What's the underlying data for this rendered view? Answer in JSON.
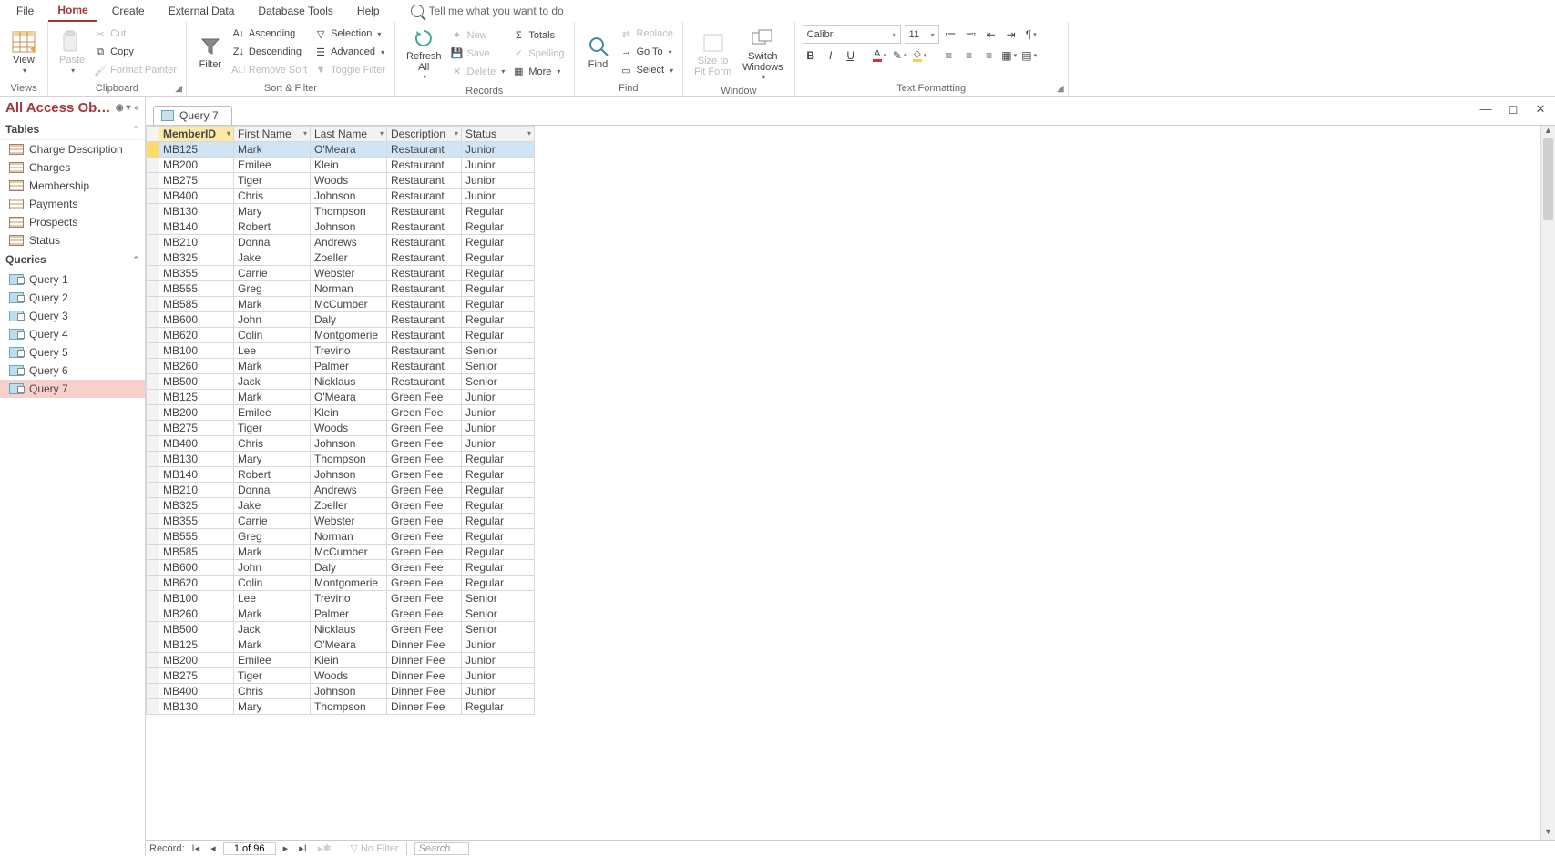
{
  "menubar": {
    "tabs": [
      "File",
      "Home",
      "Create",
      "External Data",
      "Database Tools",
      "Help"
    ],
    "active": 1,
    "tellme": "Tell me what you want to do"
  },
  "ribbon": {
    "views": {
      "label": "Views",
      "btn": "View"
    },
    "clipboard": {
      "label": "Clipboard",
      "paste": "Paste",
      "cut": "Cut",
      "copy": "Copy",
      "fp": "Format Painter"
    },
    "sortfilter": {
      "label": "Sort & Filter",
      "filter": "Filter",
      "asc": "Ascending",
      "desc": "Descending",
      "remove": "Remove Sort",
      "selection": "Selection",
      "advanced": "Advanced",
      "toggle": "Toggle Filter"
    },
    "records": {
      "label": "Records",
      "refresh": "Refresh\nAll",
      "new": "New",
      "save": "Save",
      "delete": "Delete",
      "totals": "Totals",
      "spelling": "Spelling",
      "more": "More"
    },
    "find": {
      "label": "Find",
      "find": "Find",
      "replace": "Replace",
      "goto": "Go To",
      "select": "Select"
    },
    "window": {
      "label": "Window",
      "size": "Size to\nFit Form",
      "switch": "Switch\nWindows"
    },
    "text": {
      "label": "Text Formatting",
      "font": "Calibri",
      "size": "11"
    }
  },
  "nav": {
    "title": "All Access Ob…",
    "groups": [
      {
        "name": "Tables",
        "items": [
          "Charge Description",
          "Charges",
          "Membership",
          "Payments",
          "Prospects",
          "Status"
        ],
        "type": "t"
      },
      {
        "name": "Queries",
        "items": [
          "Query 1",
          "Query 2",
          "Query 3",
          "Query 4",
          "Query 5",
          "Query 6",
          "Query 7"
        ],
        "type": "q",
        "selected": "Query 7"
      }
    ]
  },
  "doc": {
    "tab": "Query 7"
  },
  "grid": {
    "columns": [
      "MemberID",
      "First Name",
      "Last Name",
      "Description",
      "Status"
    ],
    "sorted_col": 0,
    "rows": [
      [
        "MB125",
        "Mark",
        "O'Meara",
        "Restaurant",
        "Junior"
      ],
      [
        "MB200",
        "Emilee",
        "Klein",
        "Restaurant",
        "Junior"
      ],
      [
        "MB275",
        "Tiger",
        "Woods",
        "Restaurant",
        "Junior"
      ],
      [
        "MB400",
        "Chris",
        "Johnson",
        "Restaurant",
        "Junior"
      ],
      [
        "MB130",
        "Mary",
        "Thompson",
        "Restaurant",
        "Regular"
      ],
      [
        "MB140",
        "Robert",
        "Johnson",
        "Restaurant",
        "Regular"
      ],
      [
        "MB210",
        "Donna",
        "Andrews",
        "Restaurant",
        "Regular"
      ],
      [
        "MB325",
        "Jake",
        "Zoeller",
        "Restaurant",
        "Regular"
      ],
      [
        "MB355",
        "Carrie",
        "Webster",
        "Restaurant",
        "Regular"
      ],
      [
        "MB555",
        "Greg",
        "Norman",
        "Restaurant",
        "Regular"
      ],
      [
        "MB585",
        "Mark",
        "McCumber",
        "Restaurant",
        "Regular"
      ],
      [
        "MB600",
        "John",
        "Daly",
        "Restaurant",
        "Regular"
      ],
      [
        "MB620",
        "Colin",
        "Montgomerie",
        "Restaurant",
        "Regular"
      ],
      [
        "MB100",
        "Lee",
        "Trevino",
        "Restaurant",
        "Senior"
      ],
      [
        "MB260",
        "Mark",
        "Palmer",
        "Restaurant",
        "Senior"
      ],
      [
        "MB500",
        "Jack",
        "Nicklaus",
        "Restaurant",
        "Senior"
      ],
      [
        "MB125",
        "Mark",
        "O'Meara",
        "Green Fee",
        "Junior"
      ],
      [
        "MB200",
        "Emilee",
        "Klein",
        "Green Fee",
        "Junior"
      ],
      [
        "MB275",
        "Tiger",
        "Woods",
        "Green Fee",
        "Junior"
      ],
      [
        "MB400",
        "Chris",
        "Johnson",
        "Green Fee",
        "Junior"
      ],
      [
        "MB130",
        "Mary",
        "Thompson",
        "Green Fee",
        "Regular"
      ],
      [
        "MB140",
        "Robert",
        "Johnson",
        "Green Fee",
        "Regular"
      ],
      [
        "MB210",
        "Donna",
        "Andrews",
        "Green Fee",
        "Regular"
      ],
      [
        "MB325",
        "Jake",
        "Zoeller",
        "Green Fee",
        "Regular"
      ],
      [
        "MB355",
        "Carrie",
        "Webster",
        "Green Fee",
        "Regular"
      ],
      [
        "MB555",
        "Greg",
        "Norman",
        "Green Fee",
        "Regular"
      ],
      [
        "MB585",
        "Mark",
        "McCumber",
        "Green Fee",
        "Regular"
      ],
      [
        "MB600",
        "John",
        "Daly",
        "Green Fee",
        "Regular"
      ],
      [
        "MB620",
        "Colin",
        "Montgomerie",
        "Green Fee",
        "Regular"
      ],
      [
        "MB100",
        "Lee",
        "Trevino",
        "Green Fee",
        "Senior"
      ],
      [
        "MB260",
        "Mark",
        "Palmer",
        "Green Fee",
        "Senior"
      ],
      [
        "MB500",
        "Jack",
        "Nicklaus",
        "Green Fee",
        "Senior"
      ],
      [
        "MB125",
        "Mark",
        "O'Meara",
        "Dinner Fee",
        "Junior"
      ],
      [
        "MB200",
        "Emilee",
        "Klein",
        "Dinner Fee",
        "Junior"
      ],
      [
        "MB275",
        "Tiger",
        "Woods",
        "Dinner Fee",
        "Junior"
      ],
      [
        "MB400",
        "Chris",
        "Johnson",
        "Dinner Fee",
        "Junior"
      ],
      [
        "MB130",
        "Mary",
        "Thompson",
        "Dinner Fee",
        "Regular"
      ]
    ]
  },
  "recnav": {
    "label": "Record:",
    "pos": "1 of 96",
    "nofilter": "No Filter",
    "search": "Search"
  }
}
